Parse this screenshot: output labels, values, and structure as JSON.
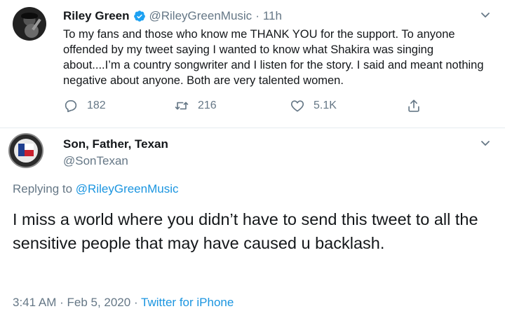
{
  "tweet": {
    "name": "Riley Green",
    "handle": "@RileyGreenMusic",
    "dot": "·",
    "time": "11h",
    "text": "To my fans and those who know me THANK YOU for the support. To anyone offended by my tweet saying I wanted to know what Shakira was singing about....I’m a country songwriter and I listen for the story. I said and meant nothing negative about anyone. Both are very talented women.",
    "replies": "182",
    "retweets": "216",
    "likes": "5.1K",
    "verified": true
  },
  "reply": {
    "name": "Son, Father, Texan",
    "handle": "@SonTexan",
    "replying_prefix": "Replying to",
    "replying_to": "@RileyGreenMusic",
    "text": "I miss a world where you didn’t have to send this tweet to all the sensitive people that may have caused u backlash.",
    "timestamp": "3:41 AM · Feb 5, 2020 ·",
    "source": "Twitter for iPhone"
  },
  "icons": {
    "reply": "reply-icon",
    "retweet": "retweet-icon",
    "like": "heart-icon",
    "share": "share-icon",
    "verified": "verified-badge-icon",
    "more": "chevron-down-icon"
  },
  "colors": {
    "text": "#14171a",
    "secondary": "#657786",
    "link": "#1b95e0",
    "verified": "#1da1f2",
    "divider": "#e6ecf0"
  }
}
